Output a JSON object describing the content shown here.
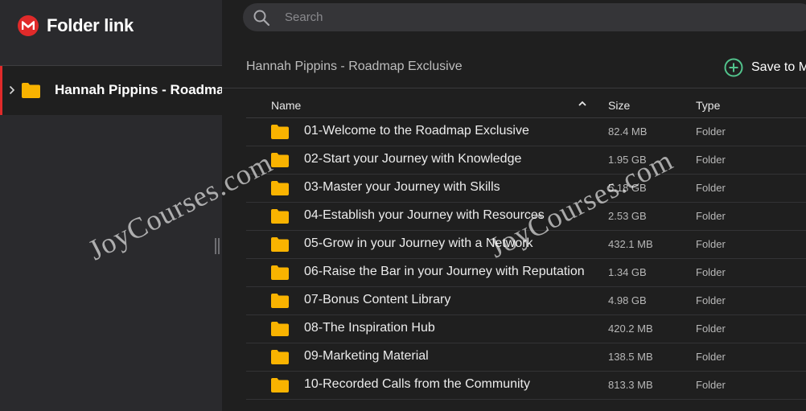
{
  "app": {
    "title": "Folder link"
  },
  "colors": {
    "brand": "#e02a2a",
    "folder": "#f9b300",
    "accent_green": "#52c38c"
  },
  "sidebar": {
    "tree_item_label": "Hannah Pippins - Roadmap Exclusive"
  },
  "search": {
    "placeholder": "Search"
  },
  "header": {
    "title": "Hannah Pippins - Roadmap Exclusive",
    "save_label": "Save to MEGA"
  },
  "table": {
    "columns": {
      "name": "Name",
      "size": "Size",
      "type": "Type"
    },
    "rows": [
      {
        "name": "01-Welcome to the Roadmap Exclusive",
        "size": "82.4 MB",
        "type": "Folder"
      },
      {
        "name": "02-Start your Journey with Knowledge",
        "size": "1.95 GB",
        "type": "Folder"
      },
      {
        "name": "03-Master your Journey with Skills",
        "size": "5.18 GB",
        "type": "Folder"
      },
      {
        "name": "04-Establish your Journey with Resources",
        "size": "2.53 GB",
        "type": "Folder"
      },
      {
        "name": "05-Grow in your Journey with a Network",
        "size": "432.1 MB",
        "type": "Folder"
      },
      {
        "name": "06-Raise the Bar in your Journey with Reputation",
        "size": "1.34 GB",
        "type": "Folder"
      },
      {
        "name": "07-Bonus Content Library",
        "size": "4.98 GB",
        "type": "Folder"
      },
      {
        "name": "08-The Inspiration Hub",
        "size": "420.2 MB",
        "type": "Folder"
      },
      {
        "name": "09-Marketing Material",
        "size": "138.5 MB",
        "type": "Folder"
      },
      {
        "name": "10-Recorded Calls from the Community",
        "size": "813.3 MB",
        "type": "Folder"
      }
    ]
  },
  "watermark": {
    "text": "JoyCourses.com"
  }
}
